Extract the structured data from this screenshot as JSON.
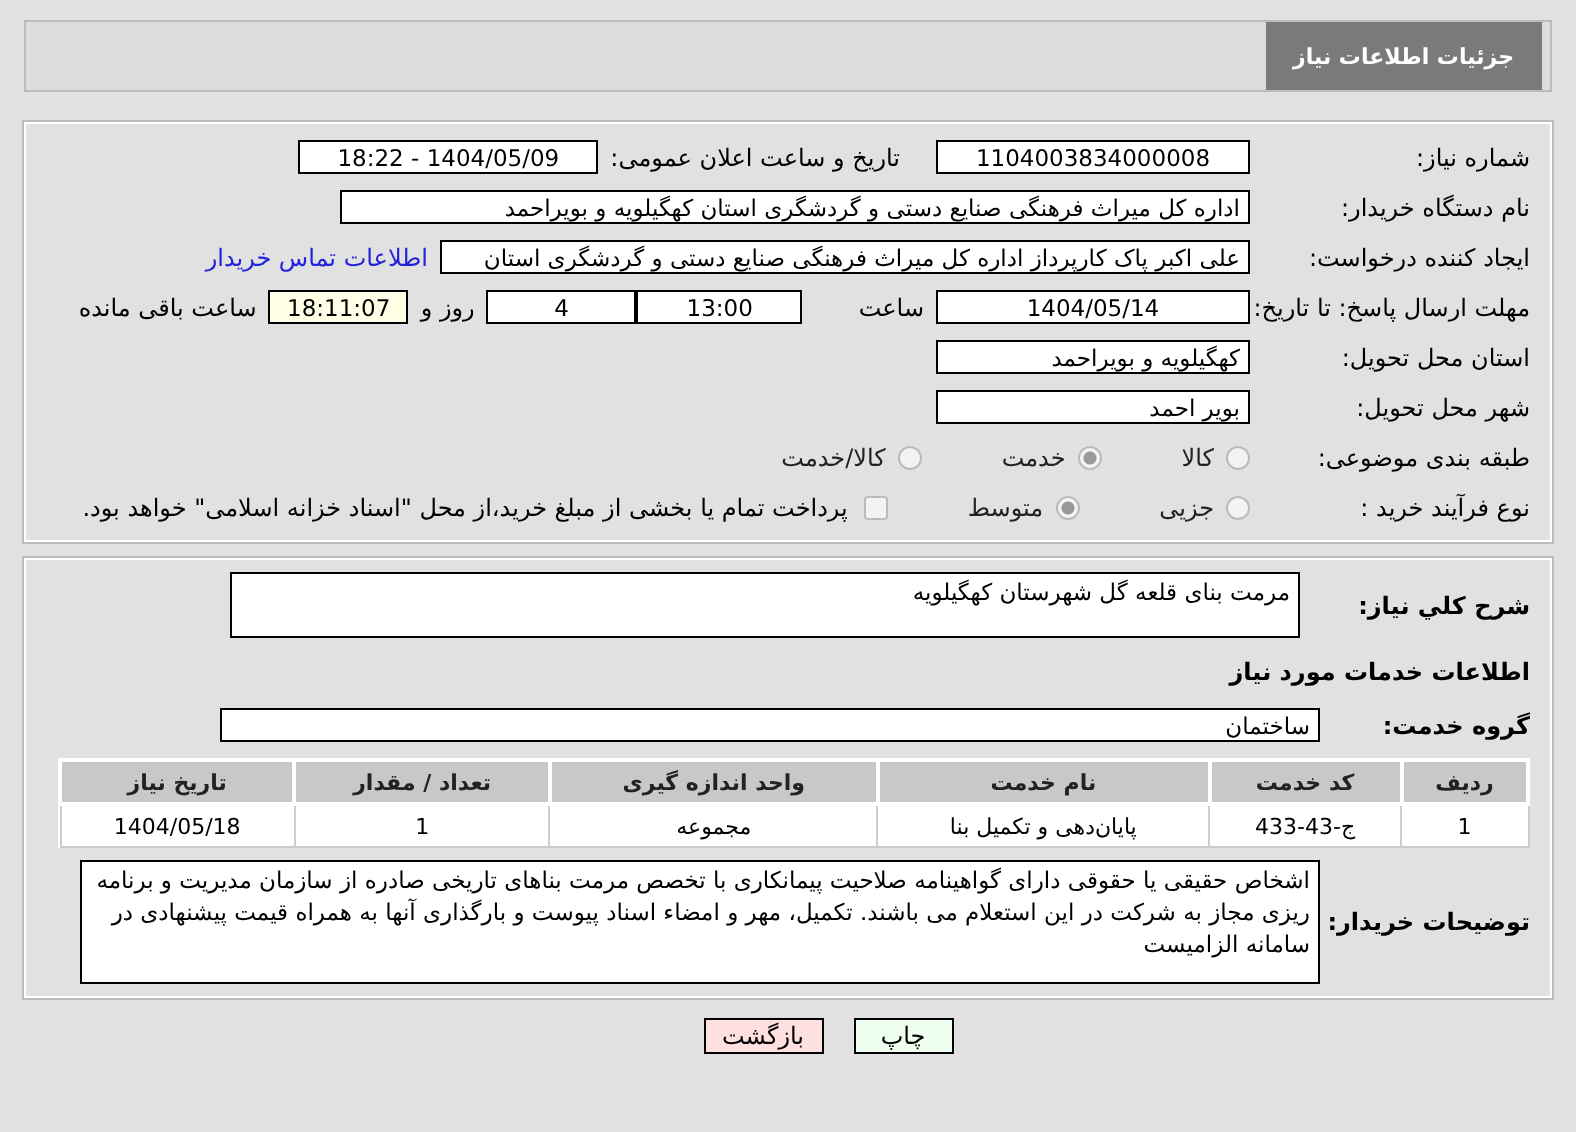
{
  "header": {
    "title": "جزئیات اطلاعات نیاز"
  },
  "details": {
    "need_number": {
      "label": "شماره نیاز:",
      "value": "1104003834000008"
    },
    "announce": {
      "label": "تاریخ و ساعت اعلان عمومی:",
      "value": "1404/05/09 - 18:22"
    },
    "buyer": {
      "label": "نام دستگاه خریدار:",
      "value": "اداره کل میراث فرهنگی  صنایع دستی و گردشگری استان کهگیلویه و بویراحمد"
    },
    "creator": {
      "label": "ایجاد کننده درخواست:",
      "value": "علی اکبر پاک کارپرداز اداره کل میراث فرهنگی  صنایع دستی و گردشگری استان",
      "link": "اطلاعات تماس خریدار"
    },
    "deadline": {
      "label": "مهلت ارسال پاسخ: تا تاریخ:",
      "date": "1404/05/14",
      "time_label": "ساعت",
      "time": "13:00",
      "days": "4",
      "days_label": "روز و",
      "remaining": "18:11:07",
      "remaining_label": "ساعت باقی مانده"
    },
    "province": {
      "label": "استان محل تحویل:",
      "value": "کهگیلویه و بویراحمد"
    },
    "city": {
      "label": "شهر محل تحویل:",
      "value": "بویر احمد"
    },
    "category": {
      "label": "طبقه بندی موضوعی:",
      "options": [
        {
          "label": "کالا",
          "selected": false
        },
        {
          "label": "خدمت",
          "selected": true
        },
        {
          "label": "کالا/خدمت",
          "selected": false
        }
      ]
    },
    "process": {
      "label": "نوع فرآیند خرید :",
      "options": [
        {
          "label": "جزیی",
          "selected": false
        },
        {
          "label": "متوسط",
          "selected": true
        }
      ],
      "payment": {
        "label": "پرداخت تمام یا بخشی از مبلغ خرید،از محل \"اسناد خزانه اسلامی\" خواهد بود.",
        "checked": false
      }
    }
  },
  "summary": {
    "label": "شرح کلي نياز:",
    "value": "مرمت بنای قلعه گل شهرستان کهگیلویه"
  },
  "services_heading": "اطلاعات خدمات مورد نیاز",
  "service_group": {
    "label": "گروه خدمت:",
    "value": "ساختمان"
  },
  "table": {
    "columns": [
      "ردیف",
      "کد خدمت",
      "نام خدمت",
      "واحد اندازه گیری",
      "تعداد / مقدار",
      "تاریخ نیاز"
    ],
    "rows": [
      [
        "1",
        "ج-43-433",
        "پایان‌دهی و تکمیل بنا",
        "مجموعه",
        "1",
        "1404/05/18"
      ]
    ]
  },
  "buyer_notes": {
    "label": "توضیحات خریدار:",
    "value": "اشخاص حقیقی یا حقوقی دارای گواهینامه صلاحیت پیمانکاری با تخصص مرمت بناهای تاریخی صادره از سازمان مدیریت و برنامه ریزی  مجاز به شرکت در این استعلام می باشند. تکمیل، مهر و امضاء اسناد پیوست و بارگذاری آنها به همراه قیمت پیشنهادی در سامانه الزامیست"
  },
  "buttons": [
    {
      "label": "چاپ",
      "kind": "print"
    },
    {
      "label": "بازگشت",
      "kind": "back"
    }
  ]
}
